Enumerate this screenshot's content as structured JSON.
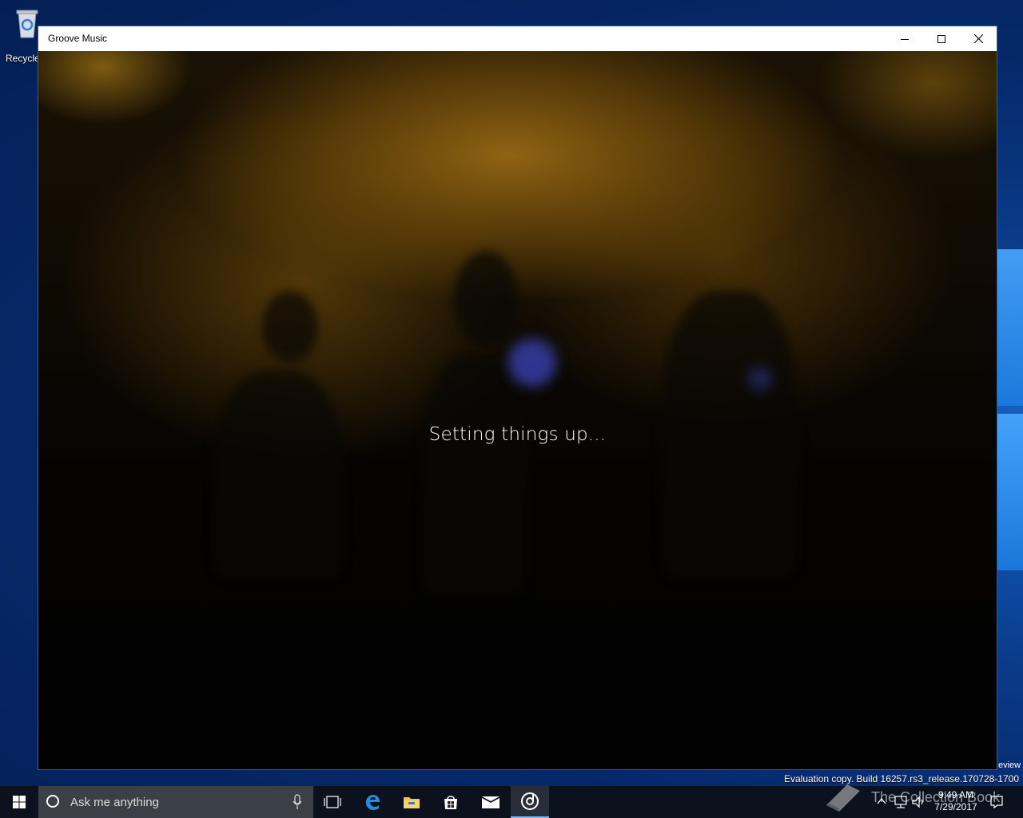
{
  "desktop": {
    "recycle_bin_label": "Recycle",
    "review_fragment": "eview",
    "evaluation_text": "Evaluation copy. Build 16257.rs3_release.170728-1700",
    "watermark_text": "The Collection Book"
  },
  "window": {
    "title": "Groove Music",
    "status_text": "Setting things up..."
  },
  "taskbar": {
    "search_placeholder": "Ask me anything",
    "items": [
      "start-icon",
      "task-view-icon",
      "edge-icon",
      "file-explorer-icon",
      "store-icon",
      "mail-icon",
      "groove-music-icon"
    ],
    "active_item": "groove-music-icon",
    "clock_time": "9:49 AM",
    "clock_date": "7/29/2017"
  },
  "colors": {
    "desktop_blue": "#0a3a88",
    "taskbar_bg": "#0c1018",
    "accent": "#7fb6ff"
  }
}
